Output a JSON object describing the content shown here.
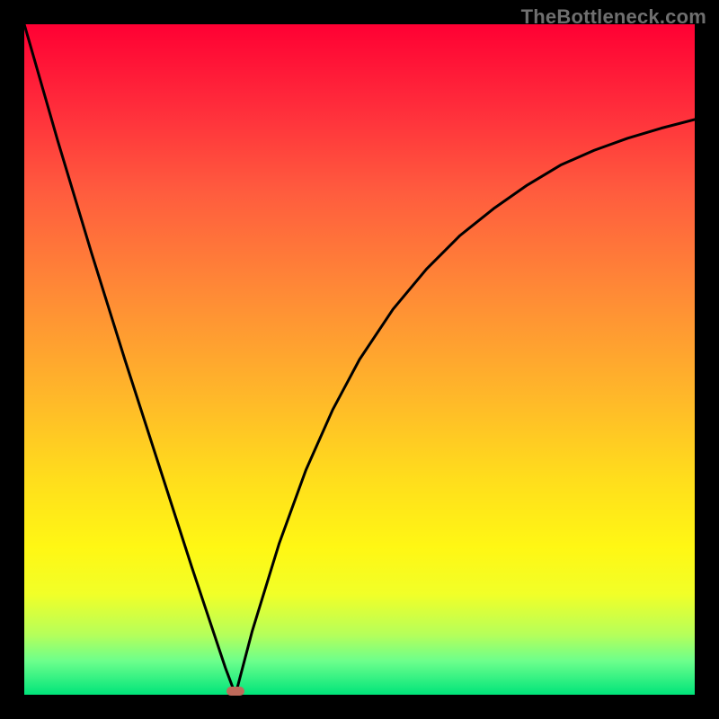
{
  "watermark": "TheBottleneck.com",
  "colors": {
    "frame": "#000000",
    "curve": "#000000",
    "cursor": "#bf6a5b"
  },
  "chart_data": {
    "type": "line",
    "title": "",
    "xlabel": "",
    "ylabel": "",
    "xlim": [
      0,
      1
    ],
    "ylim": [
      0,
      1
    ],
    "x0": 0.315,
    "series": [
      {
        "name": "left",
        "x": [
          0.0,
          0.05,
          0.1,
          0.15,
          0.2,
          0.25,
          0.3,
          0.315
        ],
        "values": [
          1.0,
          0.826,
          0.66,
          0.5,
          0.345,
          0.19,
          0.04,
          0.0
        ]
      },
      {
        "name": "right",
        "x": [
          0.315,
          0.34,
          0.38,
          0.42,
          0.46,
          0.5,
          0.55,
          0.6,
          0.65,
          0.7,
          0.75,
          0.8,
          0.85,
          0.9,
          0.95,
          1.0
        ],
        "values": [
          0.0,
          0.095,
          0.225,
          0.335,
          0.425,
          0.5,
          0.575,
          0.635,
          0.685,
          0.725,
          0.76,
          0.79,
          0.812,
          0.83,
          0.845,
          0.858
        ]
      }
    ],
    "cursor": {
      "x": 0.315,
      "y": 0.0
    }
  }
}
